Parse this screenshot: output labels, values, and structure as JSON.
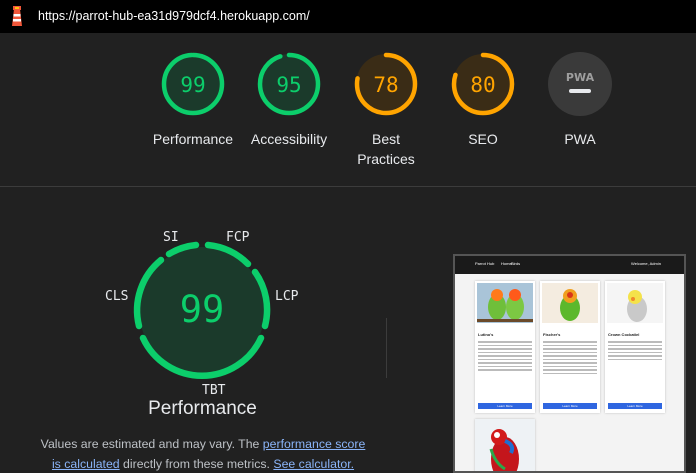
{
  "url_bar": {
    "url": "https://parrot-hub-ea31d979dcf4.herokuapp.com/"
  },
  "scores": [
    {
      "label": "Performance",
      "value": "99",
      "fraction": 0.99,
      "color": "#0cce6b"
    },
    {
      "label": "Accessibility",
      "value": "95",
      "fraction": 0.95,
      "color": "#0cce6b"
    },
    {
      "label": "Best\nPractices",
      "value": "78",
      "fraction": 0.78,
      "color": "#ffa400"
    },
    {
      "label": "SEO",
      "value": "80",
      "fraction": 0.8,
      "color": "#ffa400"
    },
    {
      "label": "PWA",
      "badge": "PWA"
    }
  ],
  "metrics_gauge": {
    "score": "99",
    "title": "Performance",
    "metrics": {
      "si": "SI",
      "fcp": "FCP",
      "lcp": "LCP",
      "tbt": "TBT",
      "cls": "CLS"
    }
  },
  "note": {
    "text_before": "Values are estimated and may vary. The ",
    "link1": "performance score is calculated",
    "text_middle": " directly from these metrics. ",
    "link2": "See calculator."
  },
  "screenshot": {
    "brand": "Parrot Hub",
    "nav1": "Home",
    "nav2": "Birds",
    "user": "Welcome, Admin",
    "cards": [
      {
        "title": "Lutino's",
        "button": "Learn More"
      },
      {
        "title": "Fischer's",
        "button": "Learn More"
      },
      {
        "title": "Crown Cockatiel",
        "button": "Learn More"
      }
    ]
  }
}
